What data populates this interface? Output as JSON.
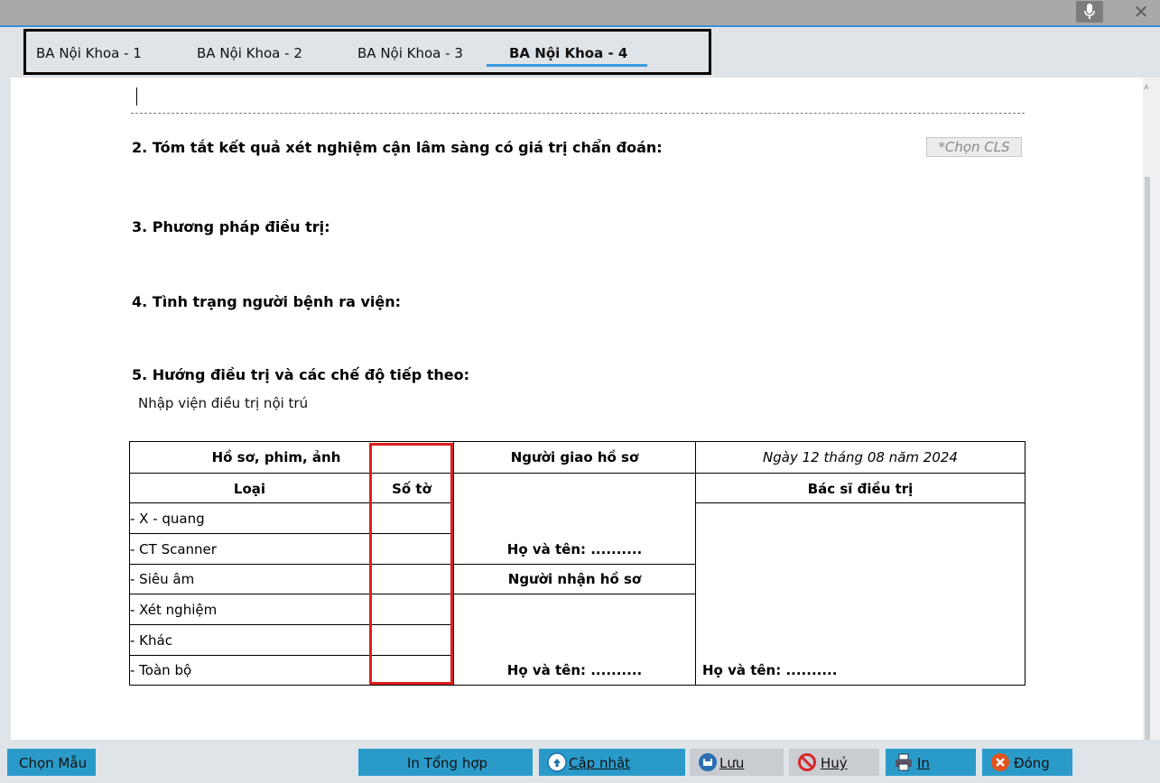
{
  "tabs": [
    {
      "label": "BA Nội Khoa - 1",
      "active": false
    },
    {
      "label": "BA Nội Khoa - 2",
      "active": false
    },
    {
      "label": "BA Nội Khoa - 3",
      "active": false
    },
    {
      "label": "BA Nội Khoa - 4",
      "active": true
    }
  ],
  "sections": {
    "s2": "2. Tóm tắt kết quả xét nghiệm cận lâm sàng có giá trị chẩn đoán:",
    "s3": "3. Phương pháp điều trị:",
    "s4": "4. Tình trạng người bệnh ra viện:",
    "s5": "5. Hướng điều trị và các chế độ tiếp theo:",
    "s5_value": "Nhập viện điều trị nội trú"
  },
  "cls_button": "*Chọn CLS",
  "table": {
    "col1_header": "Hồ sơ, phim, ảnh",
    "col_type": "Loại",
    "col_count": "Số tờ",
    "giver_header": "Người giao hồ sơ",
    "receiver_header": "Người nhận hồ sơ",
    "date_text": "Ngày 12 tháng 08 năm 2024",
    "doctor_header": "Bác sĩ điều trị",
    "name_giver": "Họ và tên: ..........",
    "name_receiver": "Họ và tên: ..........",
    "name_doctor": "Họ và tên: ..........",
    "rows": [
      "- X - quang",
      "- CT Scanner",
      "- Siêu âm",
      "- Xét nghiệm",
      "- Khác",
      "- Toàn bộ"
    ]
  },
  "buttons": {
    "template": "Chọn Mẫu",
    "print_summary": "In Tổng hợp",
    "update": "Cập nhật",
    "save": "Lưu",
    "cancel": "Huỷ",
    "print": "In",
    "close": "Đóng"
  },
  "colors": {
    "accent": "#2a9bc9",
    "highlight_border": "#e01e1e",
    "tab_underline": "#3a9be0"
  }
}
